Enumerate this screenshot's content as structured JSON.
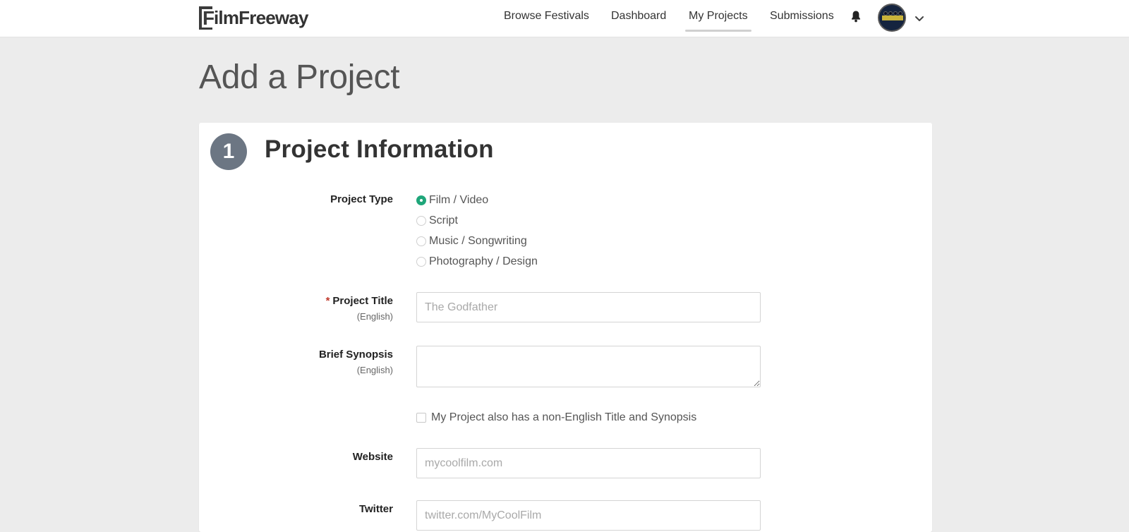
{
  "brand": {
    "name": "FilmFreeway",
    "logo_letter": "F",
    "logo_rest": "ilmFreeway"
  },
  "nav": {
    "items": [
      {
        "label": "Browse Festivals",
        "active": false
      },
      {
        "label": "Dashboard",
        "active": false
      },
      {
        "label": "My Projects",
        "active": true
      },
      {
        "label": "Submissions",
        "active": false
      }
    ],
    "icons": {
      "notifications": "bell-icon",
      "account_menu": "chevron-down-icon"
    }
  },
  "page": {
    "title": "Add a Project"
  },
  "section": {
    "step": "1",
    "title": "Project Information"
  },
  "form": {
    "project_type": {
      "label": "Project Type",
      "options": [
        {
          "label": "Film / Video",
          "selected": true
        },
        {
          "label": "Script",
          "selected": false
        },
        {
          "label": "Music / Songwriting",
          "selected": false
        },
        {
          "label": "Photography / Design",
          "selected": false
        }
      ]
    },
    "project_title": {
      "required_mark": "*",
      "label": "Project Title",
      "sublabel": "(English)",
      "value": "",
      "placeholder": "The Godfather"
    },
    "brief_synopsis": {
      "label": "Brief Synopsis",
      "sublabel": "(English)",
      "value": ""
    },
    "non_english": {
      "label": "My Project also has a non-English Title and Synopsis",
      "checked": false
    },
    "website": {
      "label": "Website",
      "value": "",
      "placeholder": "mycoolfilm.com"
    },
    "twitter": {
      "label": "Twitter",
      "value": "",
      "placeholder": "twitter.com/MyCoolFilm"
    }
  },
  "colors": {
    "accent_green": "#1fa67a",
    "required_red": "#c0392b",
    "step_circle": "#6c7683",
    "page_background": "#ececec"
  }
}
